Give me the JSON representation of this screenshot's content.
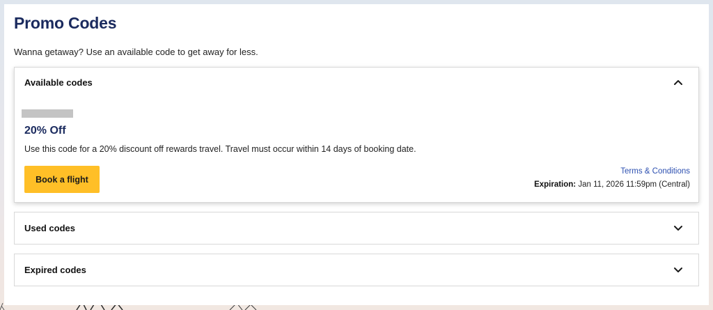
{
  "page": {
    "title": "Promo Codes",
    "subtitle": "Wanna getaway? Use an available code to get away for less."
  },
  "sections": {
    "available": {
      "title": "Available codes",
      "expanded": true,
      "icon": "chevron-up-icon",
      "promo": {
        "discount_title": "20% Off",
        "description": "Use this code for a 20% discount off rewards travel. Travel must occur within 14 days of booking date.",
        "button_label": "Book a flight",
        "terms_label": "Terms & Conditions",
        "expiration_label": "Expiration:",
        "expiration_value": "Jan 11, 2026 11:59pm (Central)"
      }
    },
    "used": {
      "title": "Used codes",
      "expanded": false,
      "icon": "chevron-down-icon"
    },
    "expired": {
      "title": "Expired codes",
      "expanded": false,
      "icon": "chevron-down-icon"
    }
  },
  "colors": {
    "heading": "#1a2a5e",
    "button": "#ffbf27",
    "link": "#2c4fb0"
  }
}
